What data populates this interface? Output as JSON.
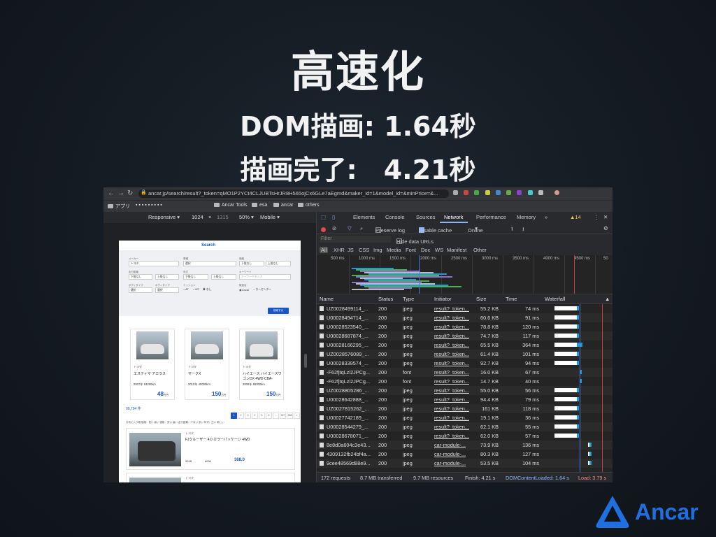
{
  "slide": {
    "title": "高速化",
    "dom_render": "DOM描画: 1.64秒",
    "complete": "描画完了:　4.21秒",
    "logo_text": "Ancar"
  },
  "browser": {
    "url": "ancar.jp/search/result?_token=qMO1P2YCt4CLJUBTsHrJR8H565ojCx6GLe7aEgmd&maker_id=1&model_id=&minPrice=&...",
    "bookmarks": [
      "アプリ",
      "Ancar Tools",
      "esa",
      "ancar",
      "others"
    ]
  },
  "device_toolbar": {
    "device": "Responsive ▾",
    "width": "1024",
    "x": "×",
    "height": "1315",
    "zoom": "50% ▾",
    "mode": "Mobile ▾"
  },
  "page": {
    "logo": "Search",
    "labels": {
      "maker": "メーカー",
      "model": "車種",
      "price": "価格",
      "year": "年式",
      "mileage": "走行距離",
      "keyword": "キーワード",
      "body": "ボディタイプ",
      "mission": "ミッション",
      "dealer": "取扱店"
    },
    "selects": {
      "maker": "トヨタ",
      "model": "選択",
      "price_min": "下限なし",
      "price_max": "上限なし",
      "mileage_min": "下限なし",
      "mileage_max": "上限なし",
      "year_min": "下限なし",
      "year_max": "上限なし",
      "keyword": "キーワードを入力",
      "body": "選択"
    },
    "radios": {
      "at": "AT",
      "mt": "MT",
      "none": "なし",
      "ancar": "Ancar",
      "center": "カーセンター"
    },
    "search_button": "検索する",
    "cards": [
      {
        "maker": "トヨタ",
        "name": "エスティマ アエラス",
        "meta": "2007年 93250km",
        "price": "48",
        "unit": "万円"
      },
      {
        "maker": "トヨタ",
        "name": "マークX",
        "meta": "2010年 40000km",
        "price": "150",
        "unit": "万円"
      },
      {
        "maker": "トヨタ",
        "name": "ハイエース ハイエースワゴンDX 4WD CBA-",
        "meta": "2006年 86000km",
        "price": "150",
        "unit": "万円"
      }
    ],
    "result_count": "99,704 件",
    "pages": [
      "1",
      "2",
      "3",
      "4",
      "5",
      "6",
      "...",
      "997",
      "998",
      "»"
    ],
    "sort_text": "お気に入り順  価格：低い  高い  価格：安い  高い  走行距離：少ない  多い  年式：古い  新しい",
    "list_cars": [
      {
        "maker": "トヨタ",
        "name": "FJクルーザー 4.0 カラーパッケージ 4WD",
        "year": "2018",
        "mileage": "6000",
        "price": "368.0"
      },
      {
        "maker": "トヨタ"
      }
    ]
  },
  "devtools": {
    "tabs": [
      "Elements",
      "Console",
      "Sources",
      "Network",
      "Performance",
      "Memory",
      "»"
    ],
    "warnings": "▲14",
    "preserve_log": "Preserve log",
    "disable_cache": "Disable cache",
    "throttle": "Online",
    "filter_placeholder": "Filter",
    "hide_data_urls": "Hide data URLs",
    "types": [
      "All",
      "XHR",
      "JS",
      "CSS",
      "Img",
      "Media",
      "Font",
      "Doc",
      "WS",
      "Manifest",
      "Other"
    ],
    "ticks": [
      "500 ms",
      "1000 ms",
      "1500 ms",
      "2000 ms",
      "2500 ms",
      "3000 ms",
      "3500 ms",
      "4000 ms",
      "4500 ms",
      "50"
    ],
    "columns": [
      "Name",
      "Status",
      "Type",
      "Initiator",
      "Size",
      "Time",
      "Waterfall"
    ],
    "rows": [
      {
        "name": "UZ0028499114_...",
        "status": "200",
        "type": "jpeg",
        "initiator": "result?_token...",
        "size": "55.2 KB",
        "time": "74 ms"
      },
      {
        "name": "U00028494714_...",
        "status": "200",
        "type": "jpeg",
        "initiator": "result?_token...",
        "size": "60.6 KB",
        "time": "91 ms"
      },
      {
        "name": "U00028523540_...",
        "status": "200",
        "type": "jpeg",
        "initiator": "result?_token...",
        "size": "78.8 KB",
        "time": "120 ms"
      },
      {
        "name": "U00028687874_...",
        "status": "200",
        "type": "jpeg",
        "initiator": "result?_token...",
        "size": "74.7 KB",
        "time": "117 ms"
      },
      {
        "name": "U00028166295_...",
        "status": "200",
        "type": "jpeg",
        "initiator": "result?_token...",
        "size": "65.5 KB",
        "time": "364 ms"
      },
      {
        "name": "UZ0028576089_...",
        "status": "200",
        "type": "jpeg",
        "initiator": "result?_token...",
        "size": "61.4 KB",
        "time": "101 ms"
      },
      {
        "name": "U00028339574_...",
        "status": "200",
        "type": "jpeg",
        "initiator": "result?_token...",
        "size": "92.7 KB",
        "time": "94 ms"
      },
      {
        "name": "-F62fjtqLzl2JPCg...",
        "status": "200",
        "type": "font",
        "initiator": "result?_token...",
        "size": "16.0 KB",
        "time": "67 ms"
      },
      {
        "name": "-F62fjtqLzl2JPCg...",
        "status": "200",
        "type": "font",
        "initiator": "result?_token...",
        "size": "14.7 KB",
        "time": "40 ms"
      },
      {
        "name": "UZ0028805286_...",
        "status": "200",
        "type": "jpeg",
        "initiator": "result?_token...",
        "size": "55.0 KB",
        "time": "56 ms"
      },
      {
        "name": "U00028642888_...",
        "status": "200",
        "type": "jpeg",
        "initiator": "result?_token...",
        "size": "94.4 KB",
        "time": "79 ms"
      },
      {
        "name": "UZ0027815262_...",
        "status": "200",
        "type": "jpeg",
        "initiator": "result?_token...",
        "size": "161 KB",
        "time": "118 ms"
      },
      {
        "name": "U00027742189_...",
        "status": "200",
        "type": "jpeg",
        "initiator": "result?_token...",
        "size": "19.1 KB",
        "time": "36 ms"
      },
      {
        "name": "U00028544279_...",
        "status": "200",
        "type": "jpeg",
        "initiator": "result?_token...",
        "size": "62.1 KB",
        "time": "55 ms"
      },
      {
        "name": "U00028678071_...",
        "status": "200",
        "type": "jpeg",
        "initiator": "result?_token...",
        "size": "62.0 KB",
        "time": "57 ms"
      },
      {
        "name": "8e8d0a604c3e43...",
        "status": "200",
        "type": "jpeg",
        "initiator": "car-module-...",
        "size": "73.9 KB",
        "time": "136 ms"
      },
      {
        "name": "4309132fb24bf4a...",
        "status": "200",
        "type": "jpeg",
        "initiator": "car-module-...",
        "size": "80.3 KB",
        "time": "127 ms"
      },
      {
        "name": "9cee48569d88e9...",
        "status": "200",
        "type": "jpeg",
        "initiator": "car-module-...",
        "size": "53.5 KB",
        "time": "104 ms"
      }
    ],
    "summary": {
      "requests": "172 requests",
      "transferred": "8.7 MB transferred",
      "resources": "9.7 MB resources",
      "finish": "Finish: 4.21 s",
      "dcl": "DOMContentLoaded: 1.64 s",
      "load": "Load: 3.79 s"
    }
  }
}
